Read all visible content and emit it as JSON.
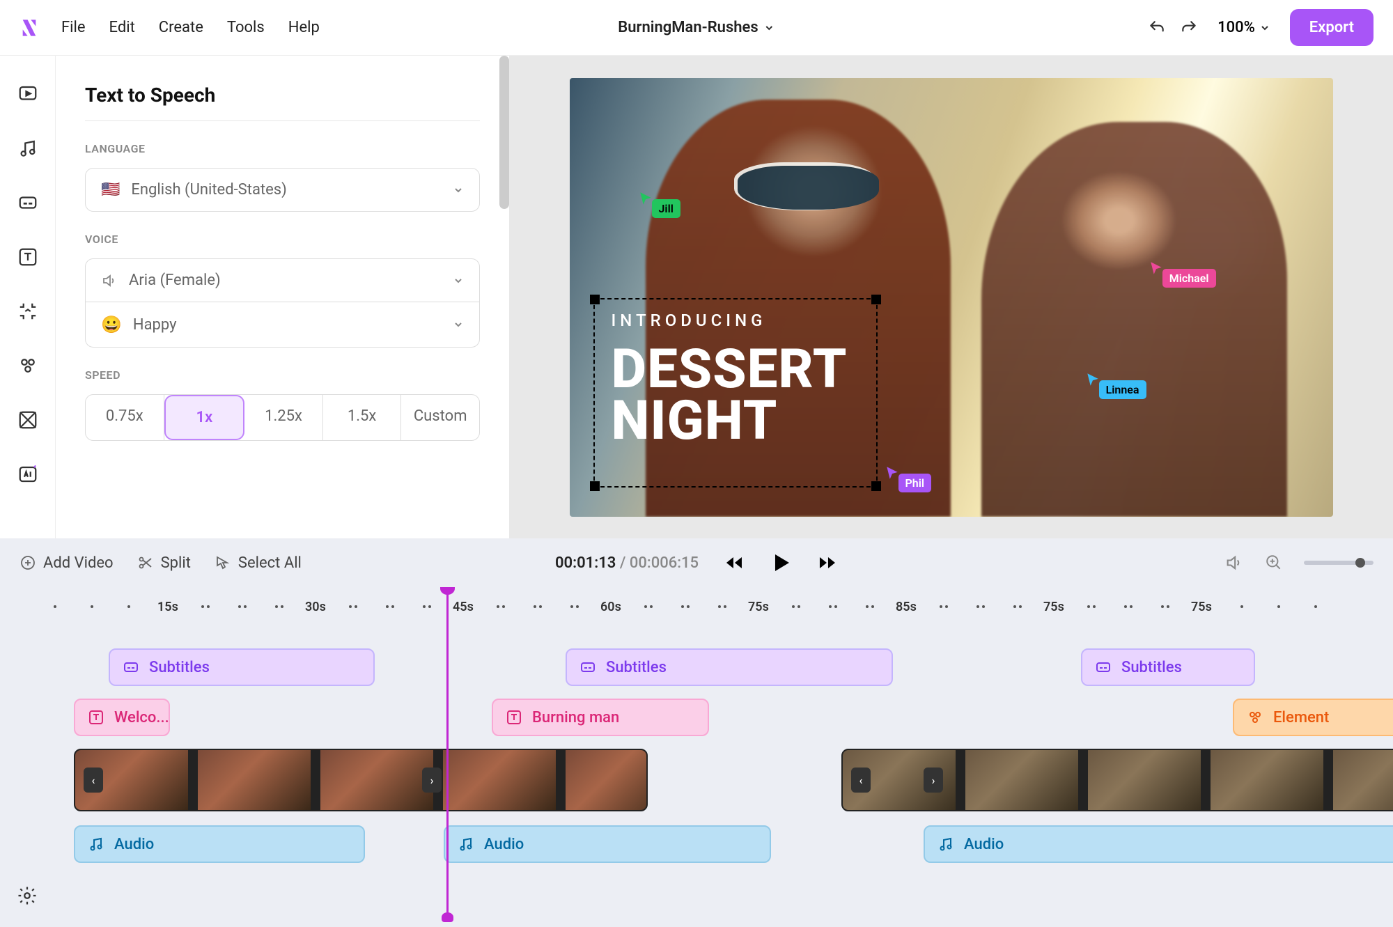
{
  "menubar": {
    "items": [
      "File",
      "Edit",
      "Create",
      "Tools",
      "Help"
    ],
    "projectTitle": "BurningMan-Rushes",
    "zoom": "100%",
    "exportLabel": "Export"
  },
  "panel": {
    "title": "Text to Speech",
    "languageLabel": "LANGUAGE",
    "languageValue": "English (United-States)",
    "languageFlag": "🇺🇸",
    "voiceLabel": "VOICE",
    "voiceValue": "Aria (Female)",
    "emotionValue": "Happy",
    "emotionEmoji": "😀",
    "speedLabel": "SPEED",
    "speedOptions": [
      "0.75x",
      "1x",
      "1.25x",
      "1.5x",
      "Custom"
    ],
    "speedActiveIndex": 1
  },
  "preview": {
    "introLine": "INTRODUCING",
    "titleLine1": "DESSERT",
    "titleLine2": "NIGHT",
    "cursors": {
      "jill": "Jill",
      "michael": "Michael",
      "linnea": "Linnea",
      "phil": "Phil"
    }
  },
  "toolbar": {
    "addVideo": "Add Video",
    "split": "Split",
    "selectAll": "Select All",
    "currentTime": "00:01:13",
    "duration": "00:006:15"
  },
  "ruler": {
    "marks": [
      "15s",
      "30s",
      "45s",
      "60s",
      "75s",
      "85s",
      "75s",
      "75s"
    ]
  },
  "tracks": {
    "subtitlesLabel": "Subtitles",
    "text1": "Welco...",
    "text2": "Burning man",
    "elementLabel": "Element",
    "audioLabel": "Audio"
  }
}
